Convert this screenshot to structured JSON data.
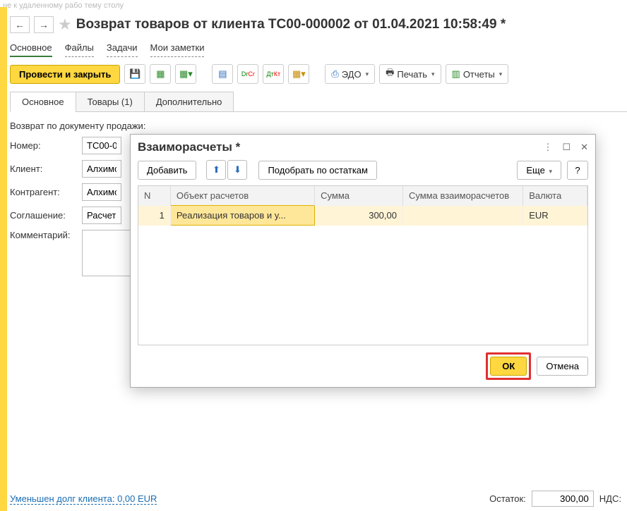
{
  "topgrey": "не к удаленному рабо тему столу",
  "nav": {
    "back": "←",
    "fwd": "→",
    "star": "★"
  },
  "title": "Возврат товаров от клиента TC00-000002 от 01.04.2021 10:58:49 *",
  "links": [
    "Основное",
    "Файлы",
    "Задачи",
    "Мои заметки"
  ],
  "toolbar": {
    "main": "Провести и закрыть",
    "edo": "ЭДО",
    "print": "Печать",
    "reports": "Отчеты"
  },
  "tabs": [
    "Основное",
    "Товары (1)",
    "Дополнительно"
  ],
  "form": {
    "note": "Возврат по документу продажи:",
    "number_lbl": "Номер:",
    "number_val": "ТС00-0",
    "client_lbl": "Клиент:",
    "client_val": "Алхимо",
    "contr_lbl": "Контрагент:",
    "contr_val": "Алхимо",
    "agree_lbl": "Соглашение:",
    "agree_val": "Расчеть",
    "comment_lbl": "Комментарий:",
    "comment_val": ""
  },
  "bottom": {
    "link": "Уменьшен долг клиента: 0,00 EUR",
    "ostatok_lbl": "Остаток:",
    "ostatok_val": "300,00",
    "nds_lbl": "НДС:"
  },
  "dialog": {
    "title": "Взаиморасчеты *",
    "more": "⋮",
    "max": "☐",
    "close": "✕",
    "add": "Добавить",
    "pick": "Подобрать по остаткам",
    "esche": "Еще",
    "help": "?",
    "cols": {
      "n": "N",
      "obj": "Объект расчетов",
      "sum": "Сумма",
      "vz": "Сумма взаиморасчетов",
      "cur": "Валюта"
    },
    "row": {
      "n": "1",
      "obj": "Реализация товаров и у...",
      "sum": "300,00",
      "vz": "",
      "cur": "EUR"
    },
    "ok": "ОК",
    "cancel": "Отмена"
  }
}
